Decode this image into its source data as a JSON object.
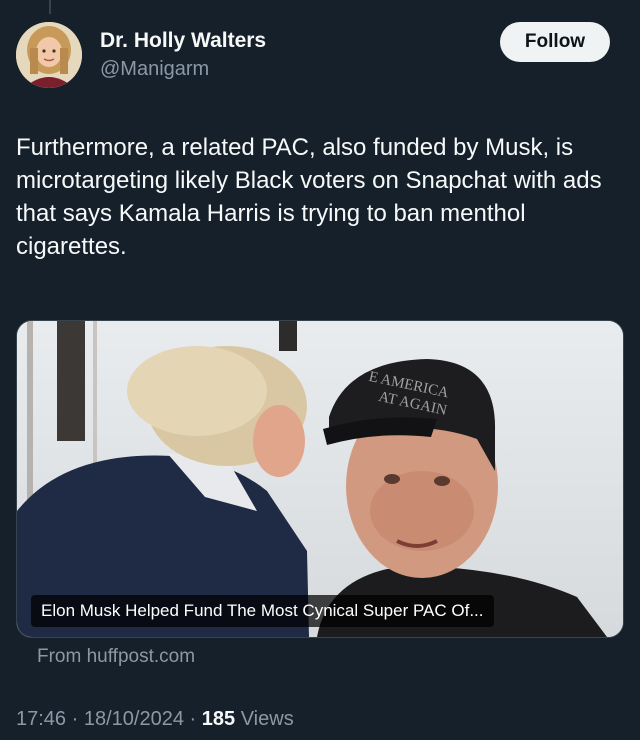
{
  "tweet": {
    "author": {
      "display_name": "Dr. Holly Walters",
      "handle": "@Manigarm",
      "avatar": "avatar-photo"
    },
    "follow_label": "Follow",
    "text": "Furthermore, a related PAC, also funded by Musk, is microtargeting likely Black voters on Snapchat with ads that says Kamala Harris is trying to ban menthol cigarettes.",
    "card": {
      "title": "Elon Musk Helped Fund The Most Cynical Super PAC Of...",
      "source": "From huffpost.com",
      "cap_text_line1": "E AMERICA",
      "cap_text_line2": "AT AGAIN"
    },
    "meta": {
      "time": "17:46",
      "date": "18/10/2024",
      "separator": "·",
      "views_count": "185",
      "views_label": "Views"
    }
  },
  "colors": {
    "background": "#15202b",
    "primary_text": "#f7f9f9",
    "secondary_text": "#8b98a5",
    "follow_bg": "#eff3f4",
    "border": "#38444d"
  }
}
